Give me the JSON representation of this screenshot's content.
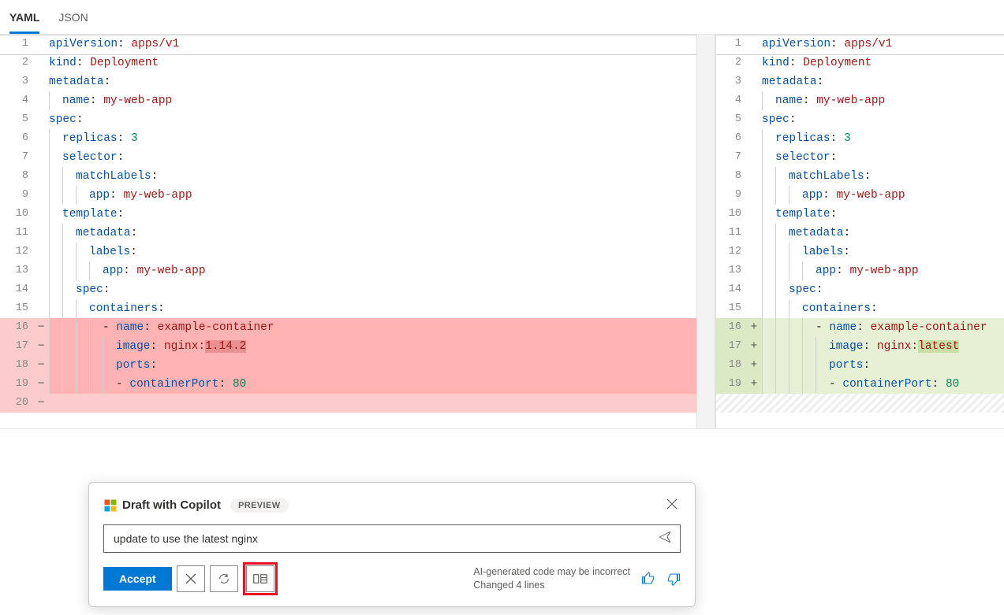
{
  "tabs": {
    "yaml": "YAML",
    "json": "JSON",
    "active": "yaml"
  },
  "left": {
    "lines": [
      {
        "n": 1,
        "mark": "",
        "diff": "",
        "indent": 0,
        "tokens": [
          [
            "key",
            "apiVersion"
          ],
          [
            "col",
            ": "
          ],
          [
            "val",
            "apps/v1"
          ]
        ]
      },
      {
        "n": 2,
        "mark": "",
        "diff": "",
        "indent": 0,
        "tokens": [
          [
            "key",
            "kind"
          ],
          [
            "col",
            ": "
          ],
          [
            "val",
            "Deployment"
          ]
        ]
      },
      {
        "n": 3,
        "mark": "",
        "diff": "",
        "indent": 0,
        "tokens": [
          [
            "key",
            "metadata"
          ],
          [
            "col",
            ":"
          ]
        ]
      },
      {
        "n": 4,
        "mark": "",
        "diff": "",
        "indent": 1,
        "tokens": [
          [
            "key",
            "name"
          ],
          [
            "col",
            ": "
          ],
          [
            "val",
            "my-web-app"
          ]
        ]
      },
      {
        "n": 5,
        "mark": "",
        "diff": "",
        "indent": 0,
        "tokens": [
          [
            "key",
            "spec"
          ],
          [
            "col",
            ":"
          ]
        ]
      },
      {
        "n": 6,
        "mark": "",
        "diff": "",
        "indent": 1,
        "tokens": [
          [
            "key",
            "replicas"
          ],
          [
            "col",
            ": "
          ],
          [
            "num",
            "3"
          ]
        ]
      },
      {
        "n": 7,
        "mark": "",
        "diff": "",
        "indent": 1,
        "tokens": [
          [
            "key",
            "selector"
          ],
          [
            "col",
            ":"
          ]
        ]
      },
      {
        "n": 8,
        "mark": "",
        "diff": "",
        "indent": 2,
        "tokens": [
          [
            "key",
            "matchLabels"
          ],
          [
            "col",
            ":"
          ]
        ]
      },
      {
        "n": 9,
        "mark": "",
        "diff": "",
        "indent": 3,
        "tokens": [
          [
            "key",
            "app"
          ],
          [
            "col",
            ": "
          ],
          [
            "val",
            "my-web-app"
          ]
        ]
      },
      {
        "n": 10,
        "mark": "",
        "diff": "",
        "indent": 1,
        "tokens": [
          [
            "key",
            "template"
          ],
          [
            "col",
            ":"
          ]
        ]
      },
      {
        "n": 11,
        "mark": "",
        "diff": "",
        "indent": 2,
        "tokens": [
          [
            "key",
            "metadata"
          ],
          [
            "col",
            ":"
          ]
        ]
      },
      {
        "n": 12,
        "mark": "",
        "diff": "",
        "indent": 3,
        "tokens": [
          [
            "key",
            "labels"
          ],
          [
            "col",
            ":"
          ]
        ]
      },
      {
        "n": 13,
        "mark": "",
        "diff": "",
        "indent": 4,
        "tokens": [
          [
            "key",
            "app"
          ],
          [
            "col",
            ": "
          ],
          [
            "val",
            "my-web-app"
          ]
        ]
      },
      {
        "n": 14,
        "mark": "",
        "diff": "",
        "indent": 2,
        "tokens": [
          [
            "key",
            "spec"
          ],
          [
            "col",
            ":"
          ]
        ]
      },
      {
        "n": 15,
        "mark": "",
        "diff": "",
        "indent": 3,
        "tokens": [
          [
            "key",
            "containers"
          ],
          [
            "col",
            ":"
          ]
        ]
      },
      {
        "n": 16,
        "mark": "−",
        "diff": "del",
        "indent": 4,
        "tokens": [
          [
            "dash",
            "- "
          ],
          [
            "key",
            "name"
          ],
          [
            "col",
            ": "
          ],
          [
            "val",
            "example-container"
          ]
        ]
      },
      {
        "n": 17,
        "mark": "−",
        "diff": "del",
        "indent": 5,
        "tokens": [
          [
            "key",
            "image"
          ],
          [
            "col",
            ": "
          ],
          [
            "val",
            "nginx:"
          ],
          [
            "hl-del",
            "1.14.2"
          ]
        ]
      },
      {
        "n": 18,
        "mark": "−",
        "diff": "del",
        "indent": 5,
        "tokens": [
          [
            "key",
            "ports"
          ],
          [
            "col",
            ":"
          ]
        ]
      },
      {
        "n": 19,
        "mark": "−",
        "diff": "del",
        "indent": 5,
        "tokens": [
          [
            "dash",
            "- "
          ],
          [
            "key",
            "containerPort"
          ],
          [
            "col",
            ": "
          ],
          [
            "num",
            "80"
          ]
        ]
      },
      {
        "n": 20,
        "mark": "−",
        "diff": "del-extra",
        "indent": 0,
        "tokens": []
      }
    ]
  },
  "right": {
    "lines": [
      {
        "n": 1,
        "mark": "",
        "diff": "",
        "indent": 0,
        "tokens": [
          [
            "key",
            "apiVersion"
          ],
          [
            "col",
            ": "
          ],
          [
            "val",
            "apps/v1"
          ]
        ]
      },
      {
        "n": 2,
        "mark": "",
        "diff": "",
        "indent": 0,
        "tokens": [
          [
            "key",
            "kind"
          ],
          [
            "col",
            ": "
          ],
          [
            "val",
            "Deployment"
          ]
        ]
      },
      {
        "n": 3,
        "mark": "",
        "diff": "",
        "indent": 0,
        "tokens": [
          [
            "key",
            "metadata"
          ],
          [
            "col",
            ":"
          ]
        ]
      },
      {
        "n": 4,
        "mark": "",
        "diff": "",
        "indent": 1,
        "tokens": [
          [
            "key",
            "name"
          ],
          [
            "col",
            ": "
          ],
          [
            "val",
            "my-web-app"
          ]
        ]
      },
      {
        "n": 5,
        "mark": "",
        "diff": "",
        "indent": 0,
        "tokens": [
          [
            "key",
            "spec"
          ],
          [
            "col",
            ":"
          ]
        ]
      },
      {
        "n": 6,
        "mark": "",
        "diff": "",
        "indent": 1,
        "tokens": [
          [
            "key",
            "replicas"
          ],
          [
            "col",
            ": "
          ],
          [
            "num",
            "3"
          ]
        ]
      },
      {
        "n": 7,
        "mark": "",
        "diff": "",
        "indent": 1,
        "tokens": [
          [
            "key",
            "selector"
          ],
          [
            "col",
            ":"
          ]
        ]
      },
      {
        "n": 8,
        "mark": "",
        "diff": "",
        "indent": 2,
        "tokens": [
          [
            "key",
            "matchLabels"
          ],
          [
            "col",
            ":"
          ]
        ]
      },
      {
        "n": 9,
        "mark": "",
        "diff": "",
        "indent": 3,
        "tokens": [
          [
            "key",
            "app"
          ],
          [
            "col",
            ": "
          ],
          [
            "val",
            "my-web-app"
          ]
        ]
      },
      {
        "n": 10,
        "mark": "",
        "diff": "",
        "indent": 1,
        "tokens": [
          [
            "key",
            "template"
          ],
          [
            "col",
            ":"
          ]
        ]
      },
      {
        "n": 11,
        "mark": "",
        "diff": "",
        "indent": 2,
        "tokens": [
          [
            "key",
            "metadata"
          ],
          [
            "col",
            ":"
          ]
        ]
      },
      {
        "n": 12,
        "mark": "",
        "diff": "",
        "indent": 3,
        "tokens": [
          [
            "key",
            "labels"
          ],
          [
            "col",
            ":"
          ]
        ]
      },
      {
        "n": 13,
        "mark": "",
        "diff": "",
        "indent": 4,
        "tokens": [
          [
            "key",
            "app"
          ],
          [
            "col",
            ": "
          ],
          [
            "val",
            "my-web-app"
          ]
        ]
      },
      {
        "n": 14,
        "mark": "",
        "diff": "",
        "indent": 2,
        "tokens": [
          [
            "key",
            "spec"
          ],
          [
            "col",
            ":"
          ]
        ]
      },
      {
        "n": 15,
        "mark": "",
        "diff": "",
        "indent": 3,
        "tokens": [
          [
            "key",
            "containers"
          ],
          [
            "col",
            ":"
          ]
        ]
      },
      {
        "n": 16,
        "mark": "+",
        "diff": "add",
        "indent": 4,
        "tokens": [
          [
            "dash",
            "- "
          ],
          [
            "key",
            "name"
          ],
          [
            "col",
            ": "
          ],
          [
            "val",
            "example-container"
          ]
        ]
      },
      {
        "n": 17,
        "mark": "+",
        "diff": "add",
        "indent": 5,
        "tokens": [
          [
            "key",
            "image"
          ],
          [
            "col",
            ": "
          ],
          [
            "val",
            "nginx:"
          ],
          [
            "hl-add",
            "latest"
          ]
        ]
      },
      {
        "n": 18,
        "mark": "+",
        "diff": "add",
        "indent": 5,
        "tokens": [
          [
            "key",
            "ports"
          ],
          [
            "col",
            ":"
          ]
        ]
      },
      {
        "n": 19,
        "mark": "+",
        "diff": "add",
        "indent": 5,
        "tokens": [
          [
            "dash",
            "- "
          ],
          [
            "key",
            "containerPort"
          ],
          [
            "col",
            ": "
          ],
          [
            "num",
            "80"
          ]
        ]
      },
      {
        "n": "",
        "mark": "",
        "diff": "hatch",
        "indent": 0,
        "tokens": []
      }
    ]
  },
  "copilot": {
    "title": "Draft with Copilot",
    "badge": "PREVIEW",
    "prompt": "update to use the latest nginx",
    "accept": "Accept",
    "note1": "AI-generated code may be incorrect",
    "note2": "Changed 4 lines"
  }
}
